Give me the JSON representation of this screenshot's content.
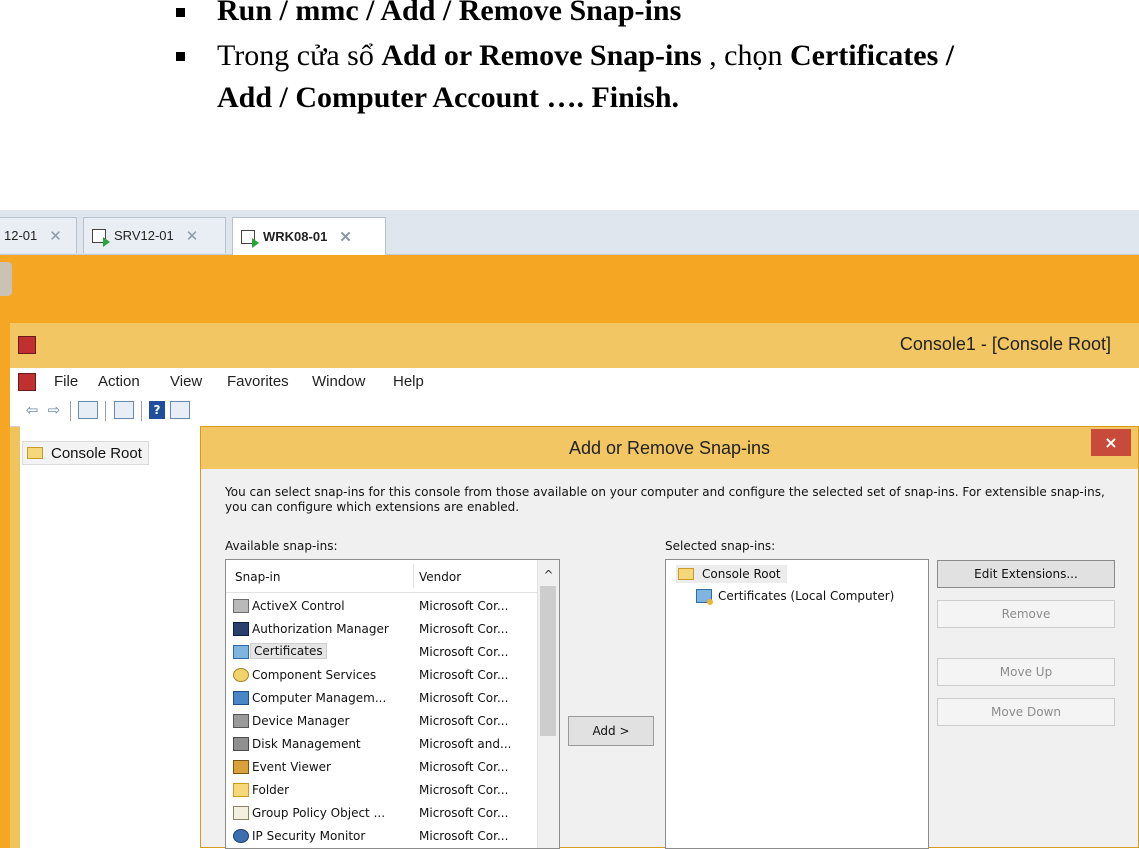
{
  "doc": {
    "bullet1": {
      "bold": "Run / mmc / Add / Remove Snap-ins"
    },
    "bullet2": {
      "text_a": "Trong cửa sổ ",
      "bold_a": "Add or Remove Snap-ins",
      "text_b": " , chọn ",
      "bold_b": "Certificates  /",
      "bold_c": "Add / Computer Account …. Finish."
    }
  },
  "vm_tabs": [
    {
      "label": "12-01"
    },
    {
      "label": "SRV12-01"
    },
    {
      "label": "WRK08-01",
      "active": true
    }
  ],
  "mmc": {
    "title": "Console1 - [Console Root]",
    "menu": [
      "File",
      "Action",
      "View",
      "Favorites",
      "Window",
      "Help"
    ],
    "tree_root": "Console Root"
  },
  "dialog": {
    "title": "Add or Remove Snap-ins",
    "close": "×",
    "description": "You can select snap-ins for this console from those available on your computer and configure the selected set of snap-ins. For extensible snap-ins, you can configure which extensions are enabled.",
    "available_label": "Available snap-ins:",
    "selected_label": "Selected snap-ins:",
    "columns": {
      "snapin": "Snap-in",
      "vendor": "Vendor"
    },
    "scroll_up": "^",
    "available": [
      {
        "name": "ActiveX Control",
        "vendor": "Microsoft Cor...",
        "icon": "activex-icon"
      },
      {
        "name": "Authorization Manager",
        "vendor": "Microsoft Cor...",
        "icon": "authorization-icon"
      },
      {
        "name": "Certificates",
        "vendor": "Microsoft Cor...",
        "icon": "certificate-icon",
        "selected": true
      },
      {
        "name": "Component Services",
        "vendor": "Microsoft Cor...",
        "icon": "component-icon"
      },
      {
        "name": "Computer Managem...",
        "vendor": "Microsoft Cor...",
        "icon": "computer-icon"
      },
      {
        "name": "Device Manager",
        "vendor": "Microsoft Cor...",
        "icon": "device-icon"
      },
      {
        "name": "Disk Management",
        "vendor": "Microsoft and...",
        "icon": "disk-icon"
      },
      {
        "name": "Event Viewer",
        "vendor": "Microsoft Cor...",
        "icon": "event-icon"
      },
      {
        "name": "Folder",
        "vendor": "Microsoft Cor...",
        "icon": "folder-icon"
      },
      {
        "name": "Group Policy Object ...",
        "vendor": "Microsoft Cor...",
        "icon": "policy-icon"
      },
      {
        "name": "IP Security Monitor",
        "vendor": "Microsoft Cor...",
        "icon": "security-icon"
      }
    ],
    "add_button": "Add >",
    "selected": {
      "root": "Console Root",
      "child": "Certificates (Local Computer)"
    },
    "buttons": {
      "edit_extensions": "Edit Extensions...",
      "remove": "Remove",
      "move_up": "Move Up",
      "move_down": "Move Down"
    }
  }
}
